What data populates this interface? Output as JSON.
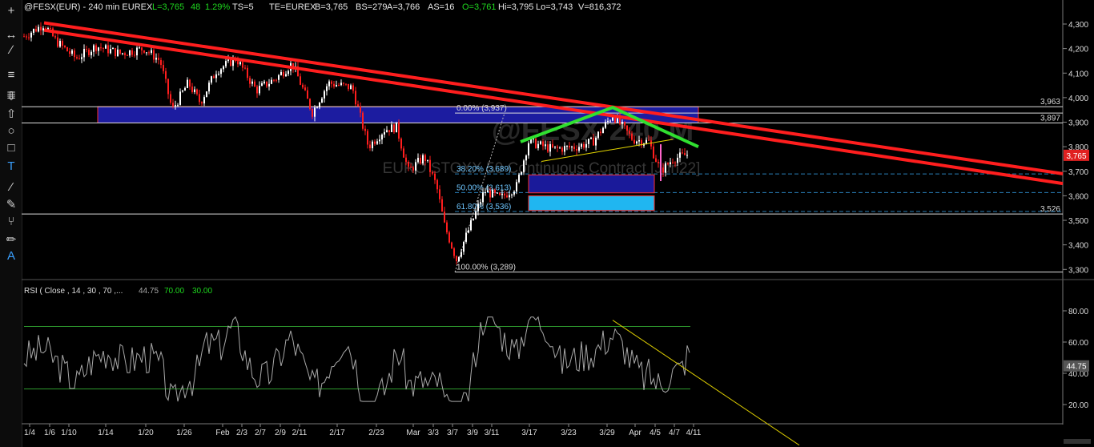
{
  "header": {
    "symbol": "@FESX(EUR)",
    "interval": "240 min",
    "exchange": "EUREX",
    "last": "L=3,765",
    "change": "48",
    "change_pct": "1.29%",
    "ts": "TS=5",
    "te": "TE=EUREX",
    "bid": "B=3,765",
    "bid_size": "BS=279",
    "ask": "A=3,766",
    "ask_size": "AS=16",
    "open": "O=3,761",
    "high": "Hi=3,795",
    "low": "Lo=3,743",
    "volume": "V=816,372"
  },
  "watermark": {
    "symbol": "@FESX 240 M",
    "description": "EURO STOXX 50 Continuous Contract [Jun22]"
  },
  "price_axis": {
    "ticks": [
      "4,300",
      "4,200",
      "4,100",
      "4,000",
      "3,900",
      "3,800",
      "3,700",
      "3,600",
      "3,500",
      "3,400",
      "3,300"
    ],
    "last_price_label": "3,765"
  },
  "level_labels": {
    "upper_box_top": "3,963",
    "upper_box_bottom": "3,897",
    "support": "3,526"
  },
  "fib_labels": [
    "0.00% (3,937)",
    "38.20% (3,689)",
    "50.00% (3,613)",
    "61.80% (3,536)",
    "100.00% (3,289)"
  ],
  "rsi": {
    "title": "RSI ( Close , 14 , 30 , 70 ,...",
    "value": "44.75",
    "overbought": "70.00",
    "oversold": "30.00",
    "ticks": [
      "80.00",
      "60.00",
      "40.00",
      "20.00"
    ],
    "last_label": "44.75"
  },
  "time_axis": [
    "1/4",
    "1/6",
    "1/10",
    "1/14",
    "1/20",
    "1/26",
    "Feb",
    "2/3",
    "2/7",
    "2/9",
    "2/11",
    "2/17",
    "2/23",
    "Mar",
    "3/3",
    "3/7",
    "3/9",
    "3/11",
    "3/17",
    "3/23",
    "3/29",
    "Apr",
    "4/5",
    "4/7",
    "4/11"
  ],
  "colors": {
    "background": "#000000",
    "up_candle": "#ffffff",
    "down_candle": "#ff1e1e",
    "trendline": "#ff1e1e",
    "neckline": "#30e030",
    "supply_zone": "#1c1ca0",
    "demand_zone": "#20b6f0",
    "rsi_line": "#a8a8a8",
    "rsi_band": "#2e9a2e",
    "rsi_trend": "#d8c800",
    "green_text": "#1ed81e",
    "header_text": "#e8e8e8"
  },
  "toolbar": {
    "icons": [
      "crosshair-icon",
      "horizontal-arrows-icon",
      "ray-tool-icon",
      "horizontal-line-icon",
      "parallel-lines-icon",
      "arrow-down-icon",
      "arrow-up-icon",
      "circle-icon",
      "rectangle-icon",
      "text-tool-icon",
      "trendline-icon",
      "pencil-dots-icon",
      "fork-icon",
      "pencil-icon",
      "text-label-icon"
    ]
  }
}
